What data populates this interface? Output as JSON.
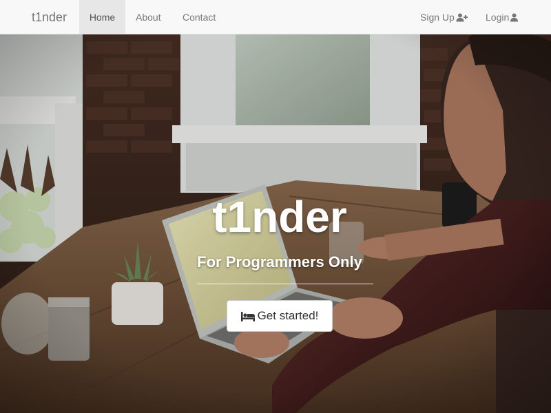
{
  "navbar": {
    "brand": "t1nder",
    "links": {
      "home": "Home",
      "about": "About",
      "contact": "Contact",
      "signup": "Sign Up",
      "login": "Login"
    },
    "icons": {
      "signup": "user-plus-icon",
      "login": "user-icon"
    },
    "active": "Home"
  },
  "hero": {
    "title": "t1nder",
    "subtitle": "For Programmers Only",
    "button_label": "Get started!",
    "button_icon": "bed-icon",
    "background": "photo of a man typing on a laptop at a wooden desk"
  },
  "colors": {
    "navbar_bg": "#f8f8f8",
    "nav_text": "#777777",
    "active_bg": "#e7e7e7",
    "hero_text": "#ffffff"
  }
}
